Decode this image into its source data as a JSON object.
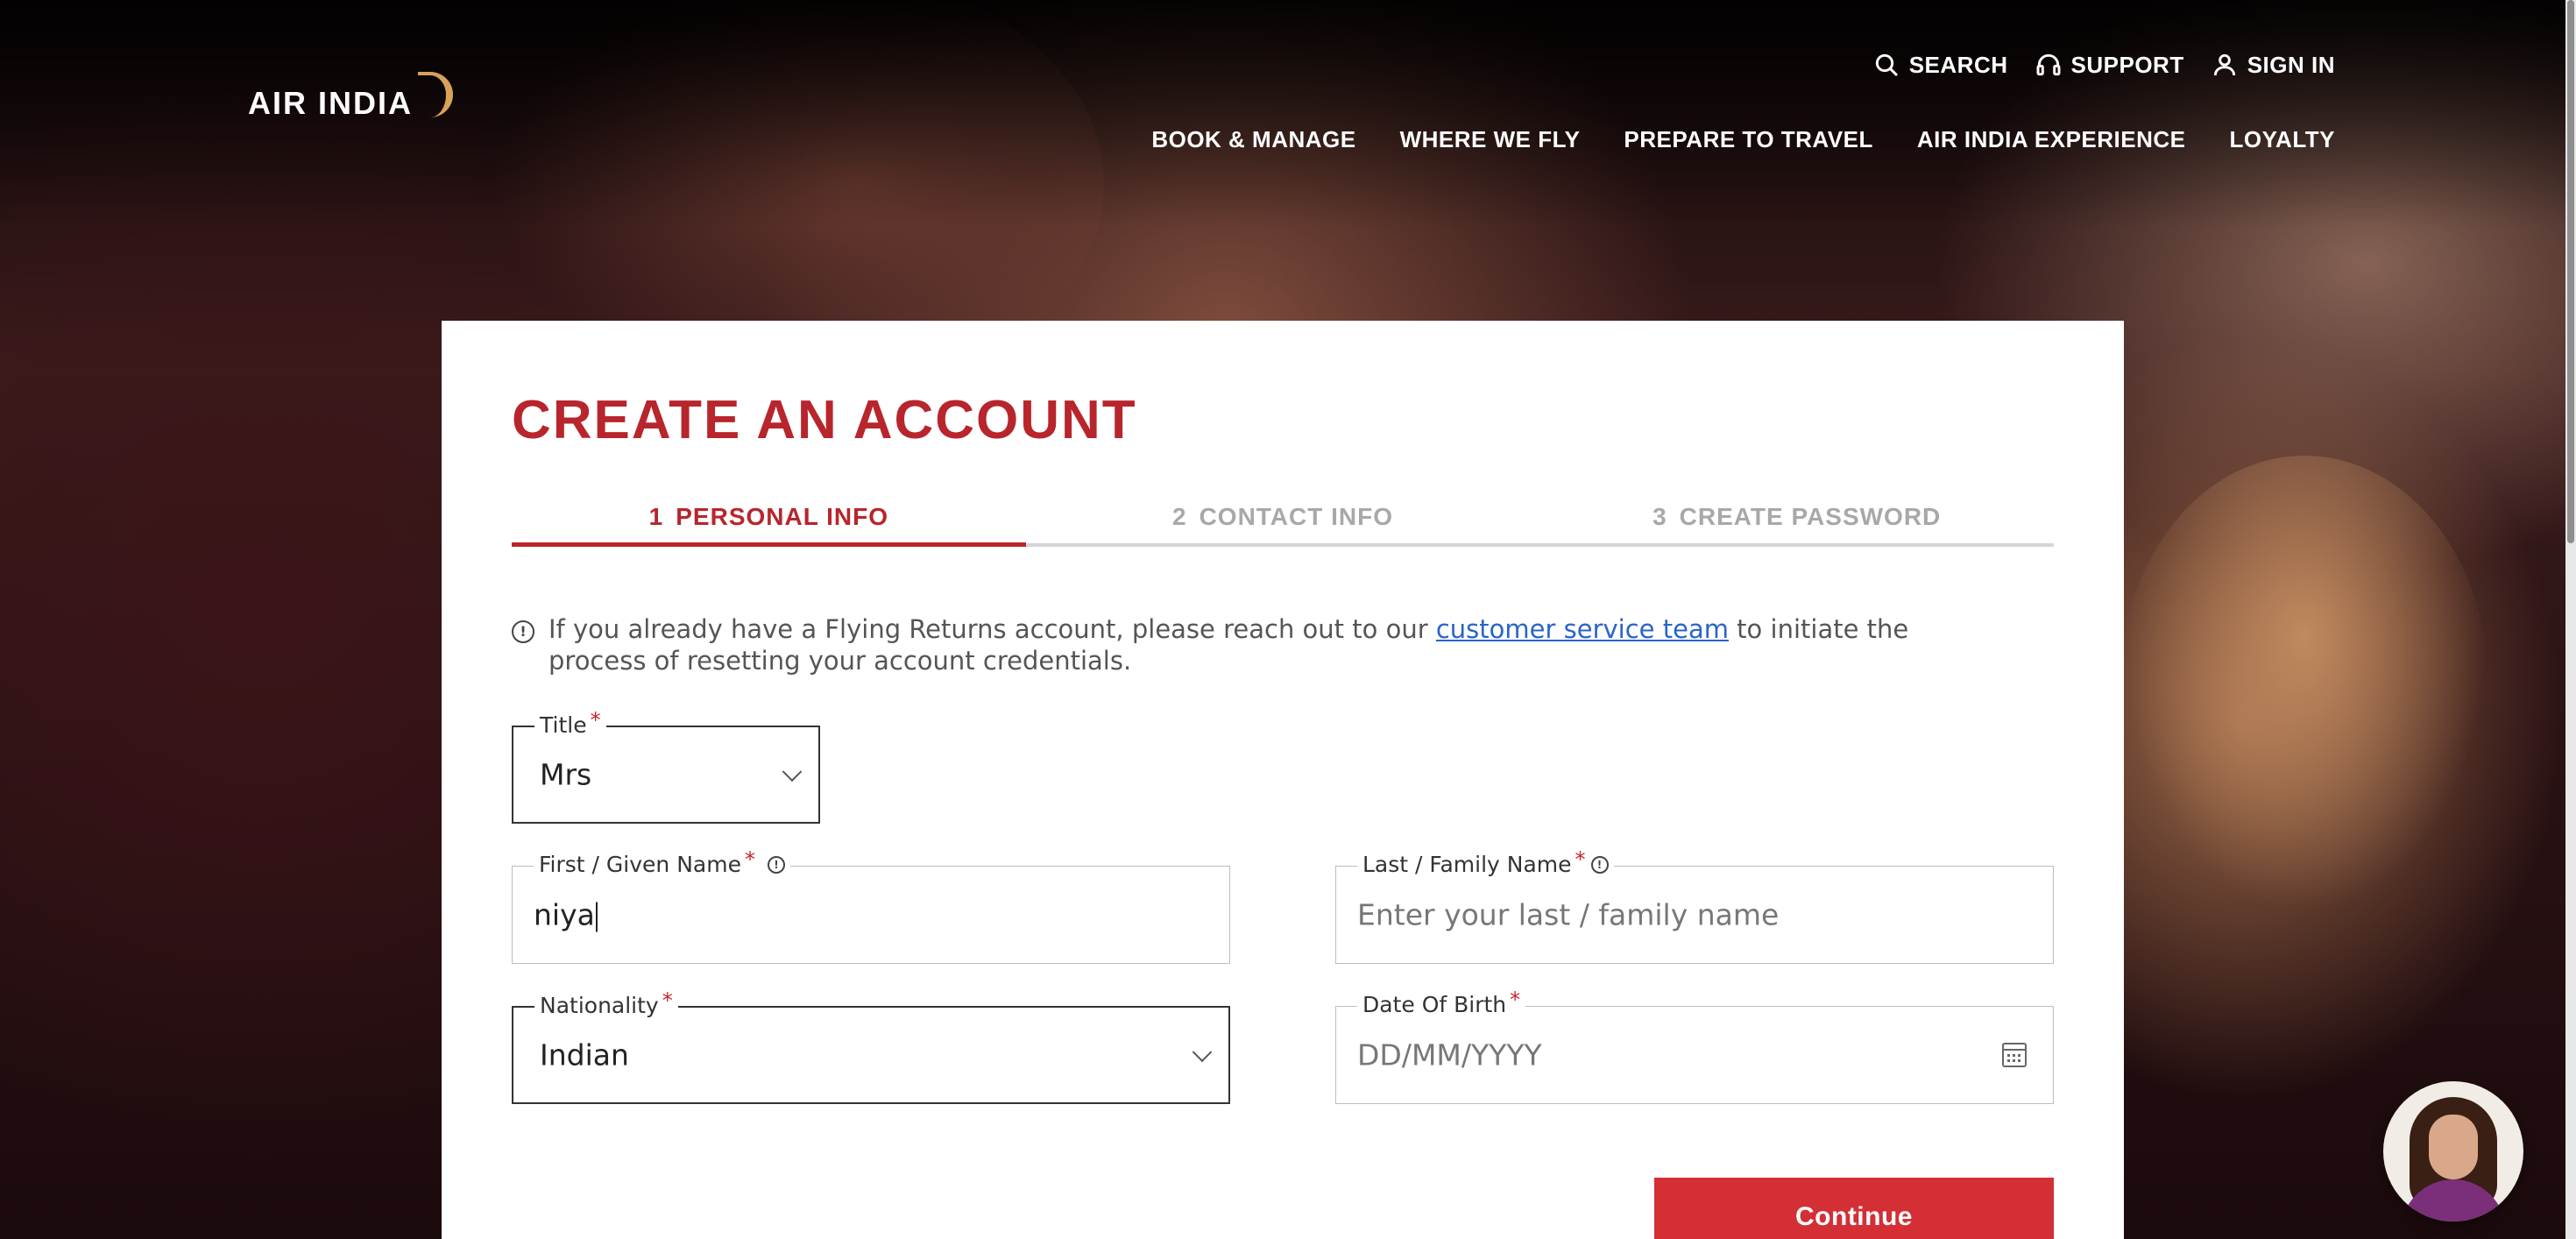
{
  "header": {
    "logo_text": "AIR INDIA",
    "util_nav": [
      {
        "label": "SEARCH",
        "icon": "search-icon"
      },
      {
        "label": "SUPPORT",
        "icon": "headset-icon"
      },
      {
        "label": "SIGN IN",
        "icon": "user-icon"
      }
    ],
    "main_nav": [
      "BOOK & MANAGE",
      "WHERE WE FLY",
      "PREPARE TO TRAVEL",
      "AIR INDIA EXPERIENCE",
      "LOYALTY"
    ]
  },
  "form": {
    "title": "CREATE AN ACCOUNT",
    "steps": [
      {
        "num": "1",
        "label": "PERSONAL INFO",
        "active": true
      },
      {
        "num": "2",
        "label": "CONTACT INFO",
        "active": false
      },
      {
        "num": "3",
        "label": "CREATE PASSWORD",
        "active": false
      }
    ],
    "info": {
      "before": "If you already have a Flying Returns account, please reach out to our ",
      "link": "customer service team",
      "after": " to initiate the process of resetting your account credentials."
    },
    "title_field": {
      "label": "Title",
      "value": "Mrs"
    },
    "first_name": {
      "label": "First / Given Name",
      "value": "niya"
    },
    "last_name": {
      "label": "Last / Family Name",
      "placeholder": "Enter your last / family name"
    },
    "nationality": {
      "label": "Nationality",
      "value": "Indian"
    },
    "dob": {
      "label": "Date Of Birth",
      "placeholder": "DD/MM/YYYY"
    },
    "required_marker": "*",
    "continue_label": "Continue"
  },
  "colors": {
    "brand_red": "#b8252c",
    "button_red": "#d32f35",
    "link_blue": "#2a64c8",
    "logo_gold": "#d8a25a"
  }
}
